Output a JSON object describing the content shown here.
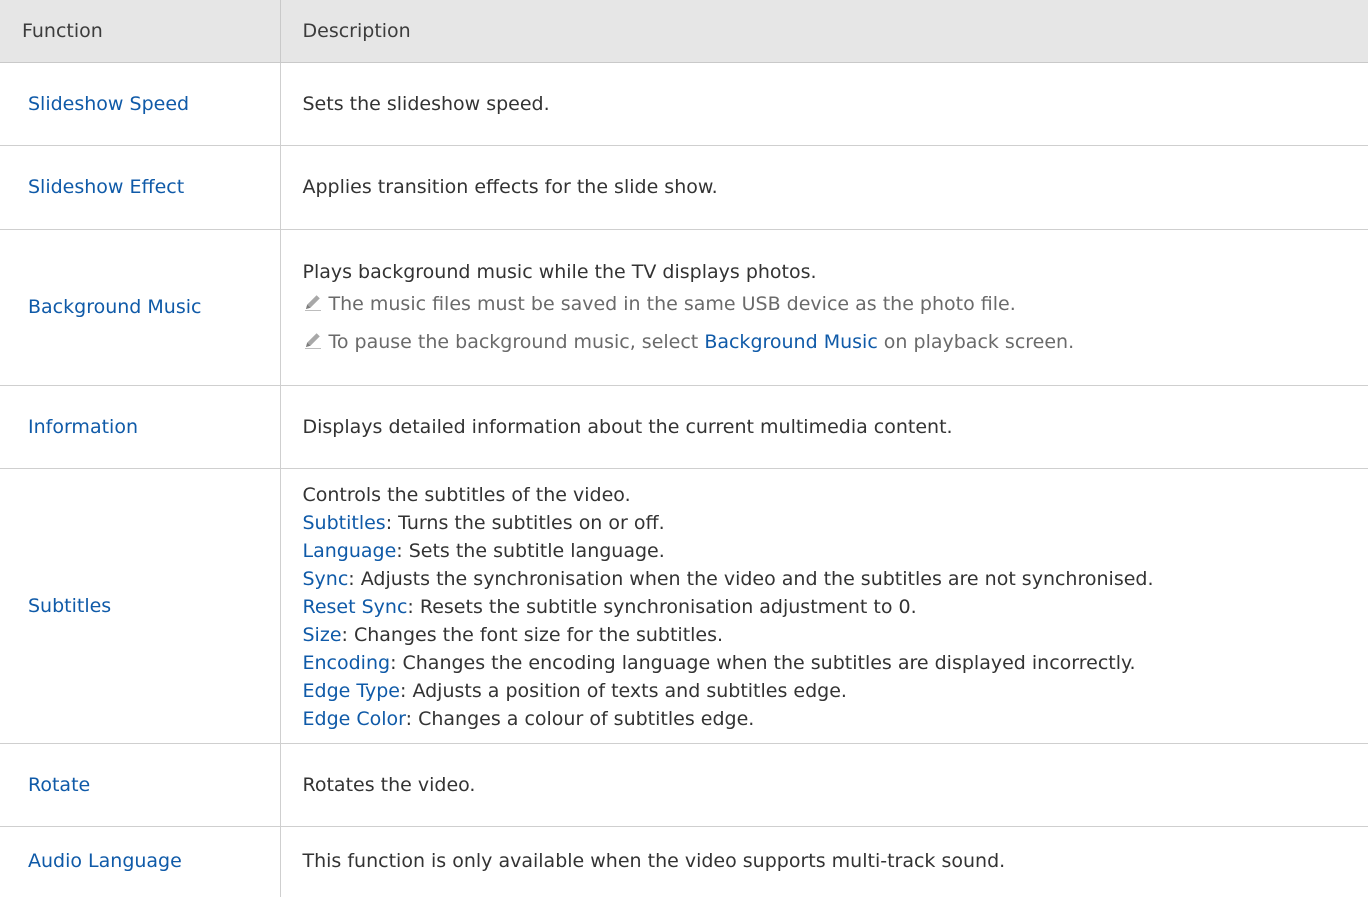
{
  "table": {
    "headers": {
      "function": "Function",
      "description": "Description"
    },
    "rows": [
      {
        "function": "Slideshow Speed",
        "description": "Sets the slideshow speed."
      },
      {
        "function": "Slideshow Effect",
        "description": "Applies transition effects for the slide show."
      },
      {
        "function": "Background Music",
        "description": "Plays background music while the TV displays photos.",
        "notes": [
          {
            "icon": "pencil-icon",
            "text": "The music files must be saved in the same USB device as the photo file."
          },
          {
            "icon": "pencil-icon",
            "prefix": "To pause the background music, select ",
            "keyword": "Background Music",
            "suffix": " on playback screen."
          }
        ]
      },
      {
        "function": "Information",
        "description": "Displays detailed information about the current multimedia content."
      },
      {
        "function": "Subtitles",
        "description": "Controls the subtitles of the video.",
        "sub_items": [
          {
            "term": "Subtitles",
            "text": ": Turns the subtitles on or off."
          },
          {
            "term": "Language",
            "text": ": Sets the subtitle language."
          },
          {
            "term": "Sync",
            "text": ": Adjusts the synchronisation when the video and the subtitles are not synchronised."
          },
          {
            "term": "Reset Sync",
            "text": ": Resets the subtitle synchronisation adjustment to 0."
          },
          {
            "term": "Size",
            "text": ": Changes the font size for the subtitles."
          },
          {
            "term": "Encoding",
            "text": ": Changes the encoding language when the subtitles are displayed incorrectly."
          },
          {
            "term": "Edge Type",
            "text": ": Adjusts a position of texts and subtitles edge."
          },
          {
            "term": "Edge Color",
            "text": ": Changes a colour of subtitles edge."
          }
        ]
      },
      {
        "function": "Rotate",
        "description": "Rotates the video."
      },
      {
        "function": "Audio Language",
        "description": "This function is only available when the video supports multi-track sound."
      }
    ]
  },
  "colors": {
    "header_bg": "#e6e6e6",
    "link_blue": "#0f5aa8",
    "body_text": "#333333",
    "note_text": "#6a6a6a",
    "rule": "#cfcfcf"
  }
}
